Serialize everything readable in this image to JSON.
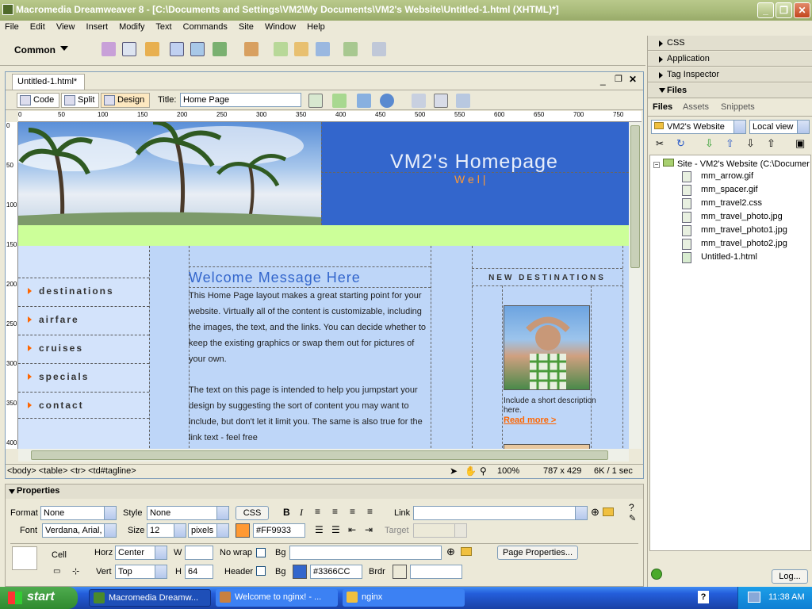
{
  "window": {
    "title": "Macromedia Dreamweaver 8 - [C:\\Documents and Settings\\VM2\\My Documents\\VM2's Website\\Untitled-1.html (XHTML)*]",
    "min": "_",
    "max": "❐",
    "close": "✕"
  },
  "menu": [
    "File",
    "Edit",
    "View",
    "Insert",
    "Modify",
    "Text",
    "Commands",
    "Site",
    "Window",
    "Help"
  ],
  "insertbar": {
    "category": "Common"
  },
  "document": {
    "tab": "Untitled-1.html*",
    "views": {
      "code": "Code",
      "split": "Split",
      "design": "Design"
    },
    "title_label": "Title:",
    "title_value": "Home Page"
  },
  "ruler": {
    "h": [
      "0",
      "50",
      "100",
      "150",
      "200",
      "250",
      "300",
      "350",
      "400",
      "450",
      "500",
      "550",
      "600",
      "650",
      "700",
      "750"
    ],
    "v": [
      "0",
      "50",
      "100",
      "150",
      "200",
      "250",
      "300",
      "350",
      "400"
    ]
  },
  "page": {
    "site_title": "VM2's Homepage",
    "tagline": "Wel|",
    "nav": [
      "destinations",
      "airfare",
      "cruises",
      "specials",
      "contact"
    ],
    "welcome": "Welcome Message Here",
    "para1": "This Home Page layout makes a great starting point for your website. Virtually all of the content is customizable, including the images, the text, and the links. You can decide whether to keep the existing graphics or swap them out for pictures of your own.",
    "para2": "The text on this page is intended to help you jumpstart your design by suggesting the sort of content you may want to include, but don't let it limit you. The same is also true for the link text - feel free",
    "new_dest": "NEW DESTINATIONS",
    "include": "Include a short description here.",
    "read_more": "Read more >"
  },
  "status": {
    "tags": "<body> <table> <tr> <td#tagline>",
    "zoom": "100%",
    "size": "787 x 429",
    "download": "6K / 1 sec"
  },
  "properties": {
    "header": "Properties",
    "format_label": "Format",
    "format": "None",
    "style_label": "Style",
    "style": "None",
    "css": "CSS",
    "bold": "B",
    "italic": "I",
    "link_label": "Link",
    "font_label": "Font",
    "font": "Verdana, Arial,",
    "size_label": "Size",
    "size": "12",
    "units": "pixels",
    "color": "#FF9933",
    "target_label": "Target",
    "cell_label": "Cell",
    "horz_label": "Horz",
    "horz": "Center",
    "w_label": "W",
    "nowrap_label": "No wrap",
    "bg_label": "Bg",
    "page_props": "Page Properties...",
    "vert_label": "Vert",
    "vert": "Top",
    "h_label": "H",
    "h": "64",
    "header_label": "Header",
    "bg_color": "#3366CC",
    "brdr_label": "Brdr"
  },
  "panels": {
    "css": "CSS",
    "application": "Application",
    "tag_inspector": "Tag Inspector",
    "files": "Files",
    "tabs": [
      "Files",
      "Assets",
      "Snippets"
    ],
    "site": "VM2's Website",
    "view": "Local view",
    "root": "Site - VM2's Website (C:\\Documer",
    "files_list": [
      "mm_arrow.gif",
      "mm_spacer.gif",
      "mm_travel2.css",
      "mm_travel_photo.jpg",
      "mm_travel_photo1.jpg",
      "mm_travel_photo2.jpg",
      "Untitled-1.html"
    ],
    "log": "Log..."
  },
  "taskbar": {
    "start": "start",
    "tasks": [
      "Macromedia Dreamw...",
      "Welcome to nginx! - ...",
      "nginx"
    ],
    "help": "?",
    "time": "11:38 AM"
  },
  "colors": {
    "header_blue": "#3366cc",
    "accent_orange": "#ff9933",
    "lime": "#ccff99"
  }
}
